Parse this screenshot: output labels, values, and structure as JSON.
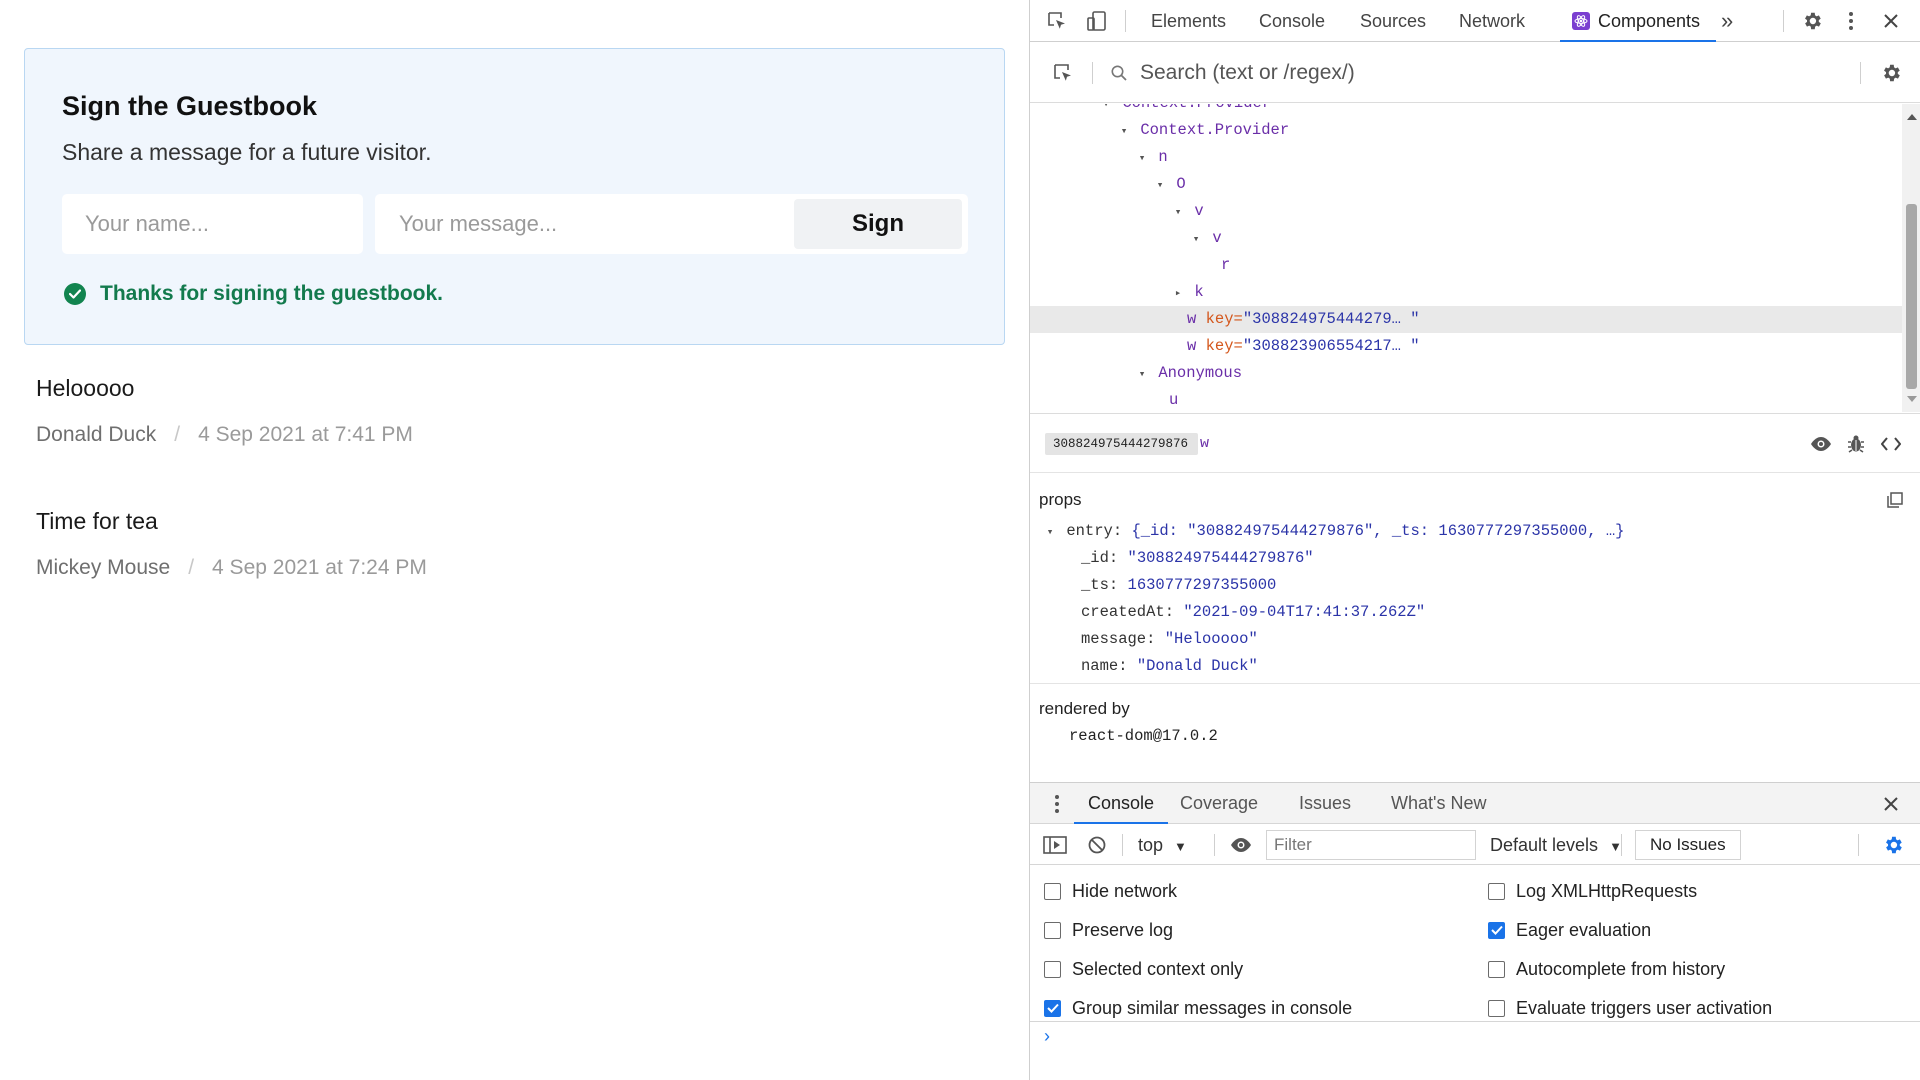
{
  "guestbook": {
    "title": "Sign the Guestbook",
    "subtitle": "Share a message for a future visitor.",
    "name_placeholder": "Your name...",
    "message_placeholder": "Your message...",
    "sign_label": "Sign",
    "success_text": "Thanks for signing the guestbook.",
    "colors": {
      "card_bg": "#f0f6fd",
      "card_border": "#b9d7f2",
      "success": "#137a4d"
    }
  },
  "entries": [
    {
      "message": "Helooooo",
      "name": "Donald Duck",
      "date": "4 Sep 2021 at 7:41 PM"
    },
    {
      "message": "Time for tea",
      "name": "Mickey Mouse",
      "date": "4 Sep 2021 at 7:24 PM"
    }
  ],
  "devtools": {
    "tabs": [
      "Elements",
      "Console",
      "Sources",
      "Network",
      "Components"
    ],
    "active_tab": "Components",
    "more_label": "»",
    "search_placeholder": "Search (text or /regex/)",
    "tree": [
      {
        "label": "Context.Provider",
        "arrow": "down",
        "partial": true
      },
      {
        "label": "Context.Provider",
        "arrow": "down"
      },
      {
        "label": "n",
        "arrow": "down"
      },
      {
        "label": "O",
        "arrow": "down"
      },
      {
        "label": "v",
        "arrow": "down"
      },
      {
        "label": "v",
        "arrow": "down"
      },
      {
        "label": "r",
        "arrow": "none"
      },
      {
        "label": "k",
        "arrow": "right"
      },
      {
        "label": "w",
        "arrow": "none",
        "key_attr": "key=",
        "key_val": "\"308824975444279… \"",
        "selected": true
      },
      {
        "label": "w",
        "arrow": "none",
        "key_attr": "key=",
        "key_val": "\"308823906554217… \""
      },
      {
        "label": "Anonymous",
        "arrow": "down"
      },
      {
        "label": "u",
        "arrow": "none"
      }
    ],
    "selected_key": "308824975444279876",
    "selected_name": "w",
    "props_title": "props",
    "props": {
      "entry_key": "entry:",
      "entry_summary": "{_id: \"308824975444279876\", _ts: 1630777297355000, …}",
      "fields": [
        {
          "key": "_id:",
          "value": "\"308824975444279876\""
        },
        {
          "key": "_ts:",
          "value": "1630777297355000"
        },
        {
          "key": "createdAt:",
          "value": "\"2021-09-04T17:41:37.262Z\""
        },
        {
          "key": "message:",
          "value": "\"Helooooo\""
        },
        {
          "key": "name:",
          "value": "\"Donald Duck\""
        }
      ]
    },
    "rendered_by_title": "rendered by",
    "rendered_by_value": "react-dom@17.0.2",
    "drawer": {
      "tabs": [
        "Console",
        "Coverage",
        "Issues",
        "What's New"
      ],
      "active_tab": "Console",
      "context": "top",
      "filter_placeholder": "Filter",
      "levels": "Default levels",
      "no_issues": "No Issues"
    },
    "settings": [
      {
        "label": "Hide network",
        "checked": false
      },
      {
        "label": "Log XMLHttpRequests",
        "checked": false
      },
      {
        "label": "Preserve log",
        "checked": false
      },
      {
        "label": "Eager evaluation",
        "checked": true
      },
      {
        "label": "Selected context only",
        "checked": false
      },
      {
        "label": "Autocomplete from history",
        "checked": false
      },
      {
        "label": "Group similar messages in console",
        "checked": true
      },
      {
        "label": "Evaluate triggers user activation",
        "checked": false
      }
    ],
    "prompt": "›",
    "accent_color": "#1a73e8"
  }
}
